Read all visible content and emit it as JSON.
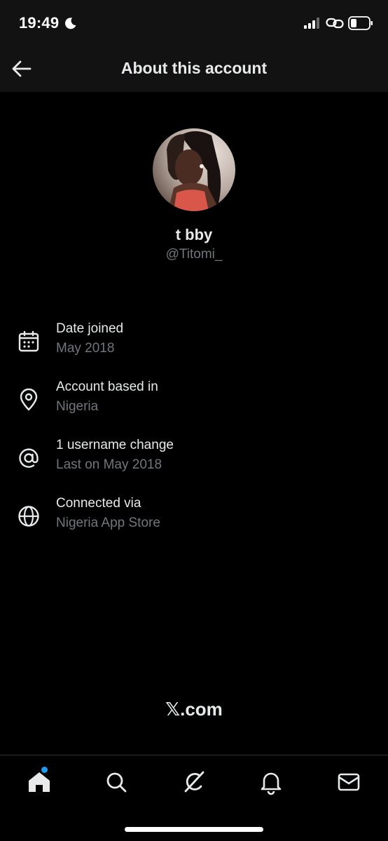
{
  "status_bar": {
    "time": "19:49",
    "icons": [
      "moon-icon",
      "signal-icon",
      "link-icon",
      "battery-icon"
    ]
  },
  "header": {
    "title": "About this account",
    "back_icon": "arrow-left-icon"
  },
  "profile": {
    "display_name": "t bby",
    "handle": "@Titomi_"
  },
  "info_items": [
    {
      "icon": "calendar-icon",
      "title": "Date joined",
      "subtitle": "May 2018"
    },
    {
      "icon": "location-pin-icon",
      "title": "Account based in",
      "subtitle": "Nigeria"
    },
    {
      "icon": "at-sign-icon",
      "title": "1 username change",
      "subtitle": "Last on May 2018"
    },
    {
      "icon": "globe-icon",
      "title": "Connected via",
      "subtitle": "Nigeria App Store"
    }
  ],
  "footer": {
    "brand": "𝕏.com"
  },
  "bottom_nav": {
    "items": [
      "home-icon",
      "search-icon",
      "grok-icon",
      "notifications-icon",
      "messages-icon"
    ],
    "home_badge": true
  },
  "colors": {
    "background": "#000000",
    "header_bg": "#121212",
    "primary_text": "#e7e9ea",
    "secondary_text": "#71767b",
    "accent": "#1d9bf0"
  }
}
